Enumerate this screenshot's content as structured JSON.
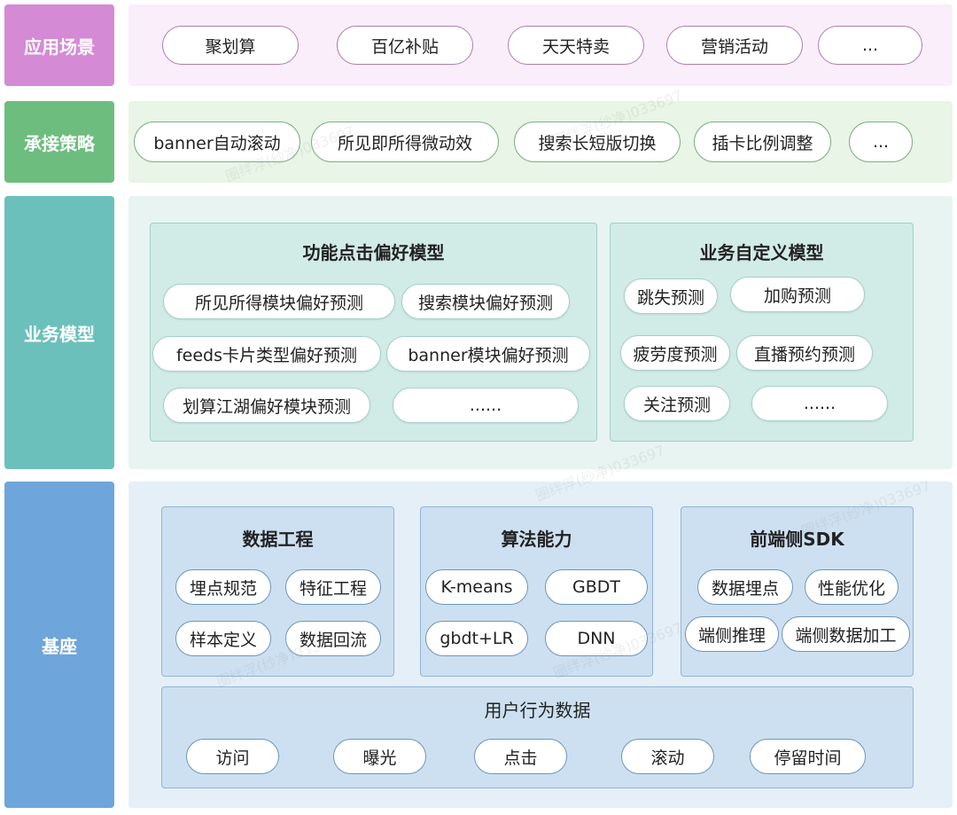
{
  "layers": {
    "application": {
      "label": "应用场景",
      "items": [
        "聚划算",
        "百亿补贴",
        "天天特卖",
        "营销活动",
        "..."
      ]
    },
    "strategy": {
      "label": "承接策略",
      "items": [
        "banner自动滚动",
        "所见即所得微动效",
        "搜索长短版切换",
        "插卡比例调整",
        "..."
      ]
    },
    "business": {
      "label": "业务模型",
      "click_model": {
        "title": "功能点击偏好模型",
        "items": [
          "所见所得模块偏好预测",
          "搜索模块偏好预测",
          "feeds卡片类型偏好预测",
          "banner模块偏好预测",
          "划算江湖偏好模块预测",
          "......"
        ]
      },
      "custom_model": {
        "title": "业务自定义模型",
        "items": [
          "跳失预测",
          "加购预测",
          "疲劳度预测",
          "直播预约预测",
          "关注预测",
          "......"
        ]
      }
    },
    "base": {
      "label": "基座",
      "data_eng": {
        "title": "数据工程",
        "items": [
          "埋点规范",
          "特征工程",
          "样本定义",
          "数据回流"
        ]
      },
      "algo": {
        "title": "算法能力",
        "items": [
          "K-means",
          "GBDT",
          "gbdt+LR",
          "DNN"
        ]
      },
      "sdk": {
        "title": "前端侧SDK",
        "items": [
          "数据埋点",
          "性能优化",
          "端侧推理",
          "端侧数据加工"
        ]
      },
      "behavior": {
        "title": "用户行为数据",
        "items": [
          "访问",
          "曝光",
          "点击",
          "滚动",
          "停留时间"
        ]
      }
    }
  },
  "watermark": "圈绊浮(纱净)033697"
}
